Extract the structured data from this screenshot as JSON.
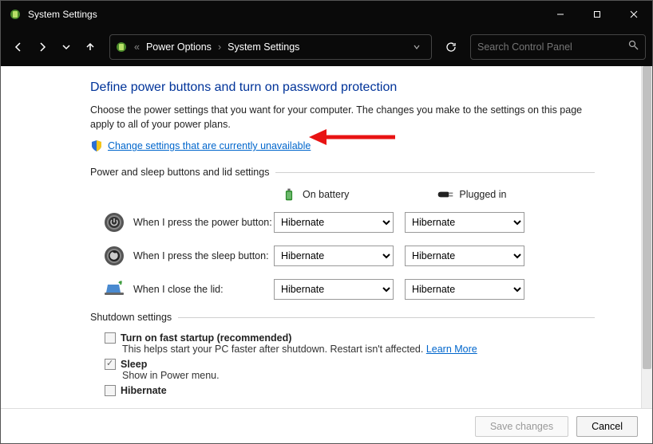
{
  "window": {
    "title": "System Settings",
    "controls": {
      "minimize": "—",
      "maximize": "▢",
      "close": "✕"
    }
  },
  "breadcrumb": {
    "seg1": "Power Options",
    "seg2": "System Settings"
  },
  "search": {
    "placeholder": "Search Control Panel"
  },
  "page": {
    "heading": "Define power buttons and turn on password protection",
    "description": "Choose the power settings that you want for your computer. The changes you make to the settings on this page apply to all of your power plans.",
    "admin_link": "Change settings that are currently unavailable",
    "section1": "Power and sleep buttons and lid settings",
    "col_battery": "On battery",
    "col_plugged": "Plugged in",
    "rows": [
      {
        "label": "When I press the power button:",
        "battery": "Hibernate",
        "plugged": "Hibernate"
      },
      {
        "label": "When I press the sleep button:",
        "battery": "Hibernate",
        "plugged": "Hibernate"
      },
      {
        "label": "When I close the lid:",
        "battery": "Hibernate",
        "plugged": "Hibernate"
      }
    ],
    "section2": "Shutdown settings",
    "shutdown": {
      "fast_label": "Turn on fast startup (recommended)",
      "fast_desc": "This helps start your PC faster after shutdown. Restart isn't affected. ",
      "learn_more": "Learn More",
      "sleep_label": "Sleep",
      "sleep_desc": "Show in Power menu.",
      "hibernate_label": "Hibernate"
    }
  },
  "footer": {
    "save": "Save changes",
    "cancel": "Cancel"
  }
}
